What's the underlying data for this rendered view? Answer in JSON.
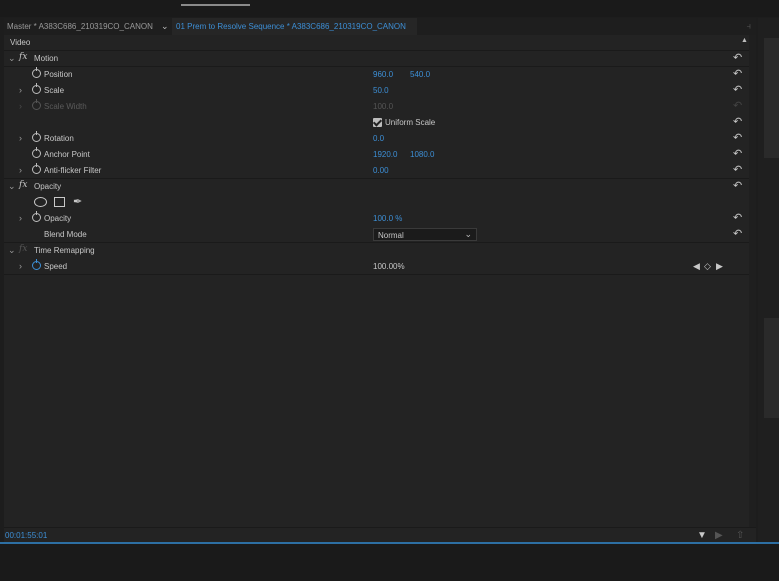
{
  "breadcrumb": {
    "master": "Master * A383C686_210319CO_CANON",
    "sequence": "01 Prem to Resolve Sequence * A383C686_210319CO_CANON"
  },
  "section_label": "Video",
  "motion": {
    "name": "Motion",
    "position": {
      "label": "Position",
      "x": "960.0",
      "y": "540.0"
    },
    "scale": {
      "label": "Scale",
      "value": "50.0"
    },
    "scale_width": {
      "label": "Scale Width",
      "value": "100.0"
    },
    "uniform_scale": {
      "label": "Uniform Scale",
      "checked": true
    },
    "rotation": {
      "label": "Rotation",
      "value": "0.0"
    },
    "anchor_point": {
      "label": "Anchor Point",
      "x": "1920.0",
      "y": "1080.0"
    },
    "anti_flicker": {
      "label": "Anti-flicker Filter",
      "value": "0.00"
    }
  },
  "opacity": {
    "name": "Opacity",
    "opacity": {
      "label": "Opacity",
      "value": "100.0 %"
    },
    "blend_mode": {
      "label": "Blend Mode",
      "value": "Normal"
    }
  },
  "time_remapping": {
    "name": "Time Remapping",
    "speed": {
      "label": "Speed",
      "value": "100.00%"
    }
  },
  "footer": {
    "timecode": "00:01:55:01"
  },
  "colors": {
    "accent": "#3d8fd6",
    "panel_bg": "#232323",
    "text": "#c8c8c8"
  },
  "icons": [
    "twirl-down-icon",
    "twirl-right-icon",
    "stopwatch-icon",
    "reset-icon",
    "ellipse-mask-icon",
    "rectangle-mask-icon",
    "pen-mask-icon",
    "keyframe-prev-icon",
    "keyframe-add-icon",
    "keyframe-next-icon",
    "filter-icon",
    "play-only-icon",
    "export-icon"
  ]
}
